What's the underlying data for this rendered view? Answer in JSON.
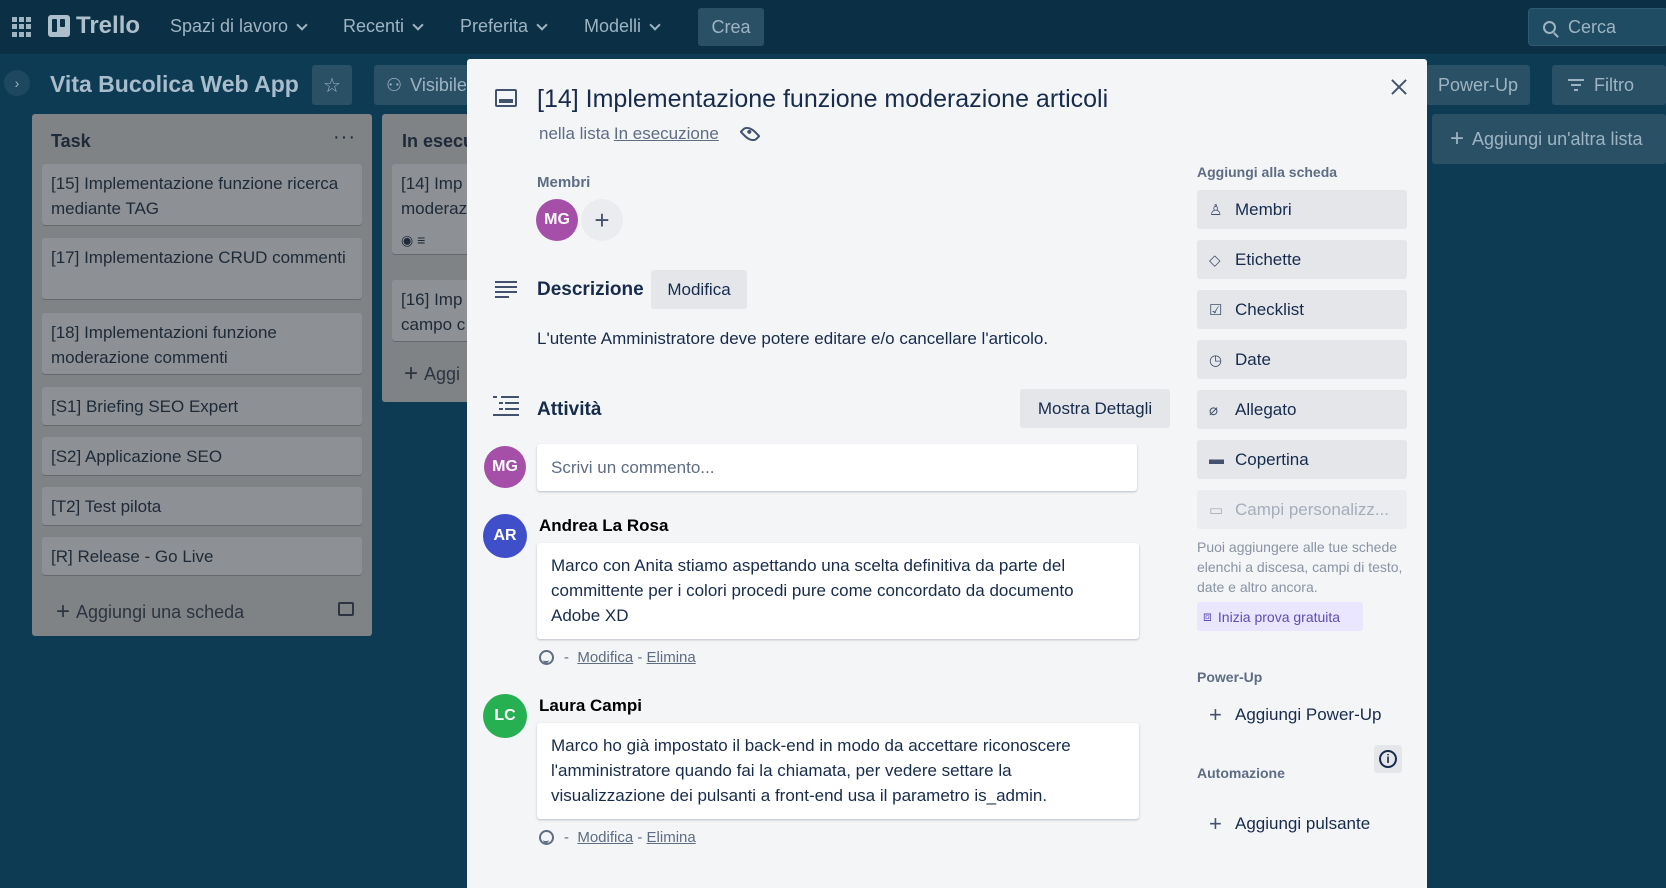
{
  "topbar": {
    "logo": "Trello",
    "nav": [
      "Spazi di lavoro",
      "Recenti",
      "Preferita",
      "Modelli"
    ],
    "create_label": "Crea",
    "search_placeholder": "Cerca"
  },
  "board": {
    "title": "Vita Bucolica Web App",
    "visibility_label": "Visibile",
    "powerup_label": "Power-Up",
    "filter_label": "Filtro",
    "add_list_label": "Aggiungi un'altra lista"
  },
  "lists": [
    {
      "title": "Task",
      "cards": [
        "[15] Implementazione funzione ricerca mediante TAG",
        "[17] Implementazione CRUD commenti",
        "[18] Implementazioni funzione moderazione commenti",
        "[S1] Briefing SEO Expert",
        "[S2] Applicazione SEO",
        "[T2] Test pilota",
        "[R] Release - Go Live"
      ],
      "add_card_label": "Aggiungi una scheda"
    },
    {
      "title": "In esecu",
      "cards": [
        "[14] Imp moderaz",
        "[16] Imp campo c"
      ],
      "add_card_label": "Aggi"
    }
  ],
  "modal": {
    "title": "[14] Implementazione funzione moderazione articoli",
    "in_list_prefix": "nella lista",
    "in_list_name": "In esecuzione",
    "members_label": "Membri",
    "member_initials": "MG",
    "description_heading": "Descrizione",
    "edit_label": "Modifica",
    "description_text": "L'utente Amministratore deve potere editare e/o cancellare l'articolo.",
    "activity_heading": "Attività",
    "show_details_label": "Mostra Dettagli",
    "comment_placeholder": "Scrivi un commento...",
    "comments": [
      {
        "initials": "AR",
        "author": "Andrea La Rosa",
        "text": "Marco con Anita stiamo aspettando una scelta definitiva da parte del committente per i colori procedi pure come concordato da documento Adobe XD",
        "separator": "-",
        "edit": "Modifica",
        "delete": "Elimina"
      },
      {
        "initials": "LC",
        "author": "Laura Campi",
        "text": "Marco ho già impostato il back-end in modo da accettare riconoscere l'amministratore quando fai la chiamata, per vedere settare la visualizzazione dei pulsanti a front-end usa il parametro is_admin.",
        "separator": "-",
        "edit": "Modifica",
        "delete": "Elimina"
      }
    ],
    "sidebar": {
      "add_to_card_label": "Aggiungi alla scheda",
      "buttons": [
        "Membri",
        "Etichette",
        "Checklist",
        "Date",
        "Allegato",
        "Copertina",
        "Campi personalizz..."
      ],
      "note": "Puoi aggiungere alle tue schede elenchi a discesa, campi di testo, date e altro ancora.",
      "trial_label": "Inizia prova gratuita",
      "powerup_heading": "Power-Up",
      "add_powerup_label": "Aggiungi Power-Up",
      "automation_heading": "Automazione",
      "add_button_label": "Aggiungi pulsante"
    }
  },
  "colors": {
    "avatar_mg": "#a54fa8",
    "avatar_ar": "#3e4fc9",
    "avatar_lc": "#27b052"
  }
}
